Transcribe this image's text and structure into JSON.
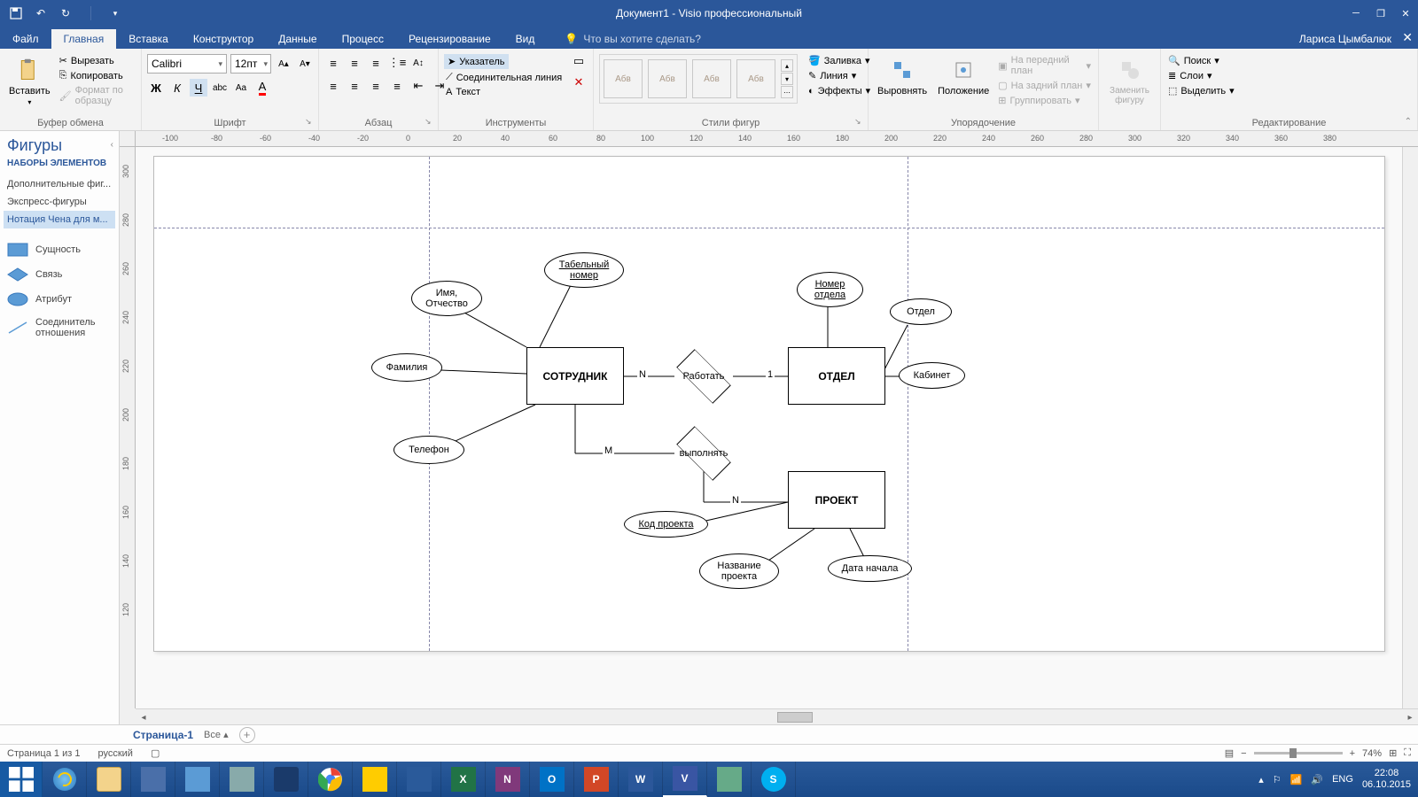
{
  "titlebar": {
    "title": "Документ1 - Visio профессиональный"
  },
  "tabs": {
    "file": "Файл",
    "home": "Главная",
    "insert": "Вставка",
    "design": "Конструктор",
    "data": "Данные",
    "process": "Процесс",
    "review": "Рецензирование",
    "view": "Вид",
    "tellme": "Что вы хотите сделать?",
    "user": "Лариса Цымбалюк"
  },
  "ribbon": {
    "clipboard": {
      "paste": "Вставить",
      "cut": "Вырезать",
      "copy": "Копировать",
      "format_painter": "Формат по образцу",
      "label": "Буфер обмена"
    },
    "font": {
      "name": "Calibri",
      "size": "12пт",
      "label": "Шрифт"
    },
    "paragraph": {
      "label": "Абзац"
    },
    "tools": {
      "pointer": "Указатель",
      "connector": "Соединительная линия",
      "text": "Текст",
      "label": "Инструменты"
    },
    "styles": {
      "label": "Стили фигур",
      "sample": "Абв",
      "fill": "Заливка",
      "line": "Линия",
      "effects": "Эффекты"
    },
    "arrange": {
      "align": "Выровнять",
      "position": "Положение",
      "front": "На передний план",
      "back": "На задний план",
      "group": "Группировать",
      "label": "Упорядочение"
    },
    "change": {
      "change_shape": "Заменить фигуру"
    },
    "editing": {
      "find": "Поиск",
      "layers": "Слои",
      "select": "Выделить",
      "label": "Редактирование"
    }
  },
  "shapes": {
    "title": "Фигуры",
    "subtitle": "НАБОРЫ ЭЛЕМЕНТОВ",
    "more": "Дополнительные фиг...",
    "quick": "Экспресс-фигуры",
    "chen": "Нотация Чена для м...",
    "entity": "Сущность",
    "relationship": "Связь",
    "attribute": "Атрибут",
    "connector": "Соединитель отношения"
  },
  "diagram": {
    "employee": "СОТРУДНИК",
    "department": "ОТДЕЛ",
    "project": "ПРОЕКТ",
    "work": "Работать",
    "execute": "выполнять",
    "tab_num": "Табельный номер",
    "name_patr": "Имя, Отчество",
    "surname": "Фамилия",
    "phone": "Телефон",
    "dept_num": "Номер отдела",
    "dept": "Отдел",
    "office": "Кабинет",
    "proj_code": "Код проекта",
    "proj_name": "Название проекта",
    "start_date": "Дата начала",
    "N": "N",
    "M": "M",
    "one": "1"
  },
  "page_tabs": {
    "page1": "Страница-1",
    "all": "Все"
  },
  "status": {
    "page": "Страница 1 из 1",
    "lang": "русский",
    "zoom": "74%"
  },
  "tray": {
    "lang": "ENG",
    "time": "22:08",
    "date": "06.10.2015"
  }
}
